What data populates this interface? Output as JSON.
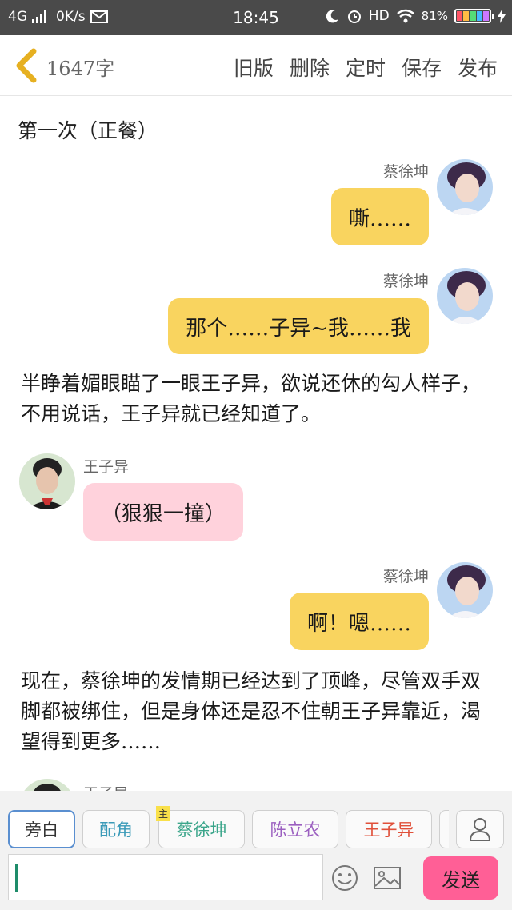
{
  "status_bar": {
    "network": "4G",
    "speed": "0K/s",
    "time": "18:45",
    "hd": "HD",
    "battery": "81%"
  },
  "toolbar": {
    "word_count": "1647字",
    "actions": [
      "旧版",
      "删除",
      "定时",
      "保存",
      "发布"
    ]
  },
  "chapter_title": "第一次（正餐）",
  "messages": [
    {
      "type": "right",
      "speaker": "蔡徐坤",
      "text": "嘶……"
    },
    {
      "type": "right",
      "speaker": "蔡徐坤",
      "text": "那个……子异~我……我"
    },
    {
      "type": "narration",
      "text": "半睁着媚眼瞄了一眼王子异，欲说还休的勾人样子，不用说话，王子异就已经知道了。"
    },
    {
      "type": "left",
      "speaker": "王子异",
      "text": "（狠狠一撞）"
    },
    {
      "type": "right",
      "speaker": "蔡徐坤",
      "text": "啊！嗯……"
    },
    {
      "type": "narration",
      "text": "现在，蔡徐坤的发情期已经达到了顶峰，尽管双手双脚都被绑住，但是身体还是忍不住朝王子异靠近，渴望得到更多……"
    },
    {
      "type": "left",
      "speaker": "王子异",
      "text": ""
    }
  ],
  "roles": [
    {
      "label": "旁白",
      "color": "#333333"
    },
    {
      "label": "配角",
      "color": "#3a9ab8"
    },
    {
      "label": "蔡徐坤",
      "color": "#3aa58a",
      "tag": "主"
    },
    {
      "label": "陈立农",
      "color": "#9b5fc0"
    },
    {
      "label": "王子异",
      "color": "#e0503a"
    }
  ],
  "composer": {
    "placeholder": "",
    "send_label": "发送"
  },
  "colors": {
    "bubble_self": "#f9d45f",
    "bubble_other": "#ffd2dc",
    "send_button": "#ff5f96"
  }
}
